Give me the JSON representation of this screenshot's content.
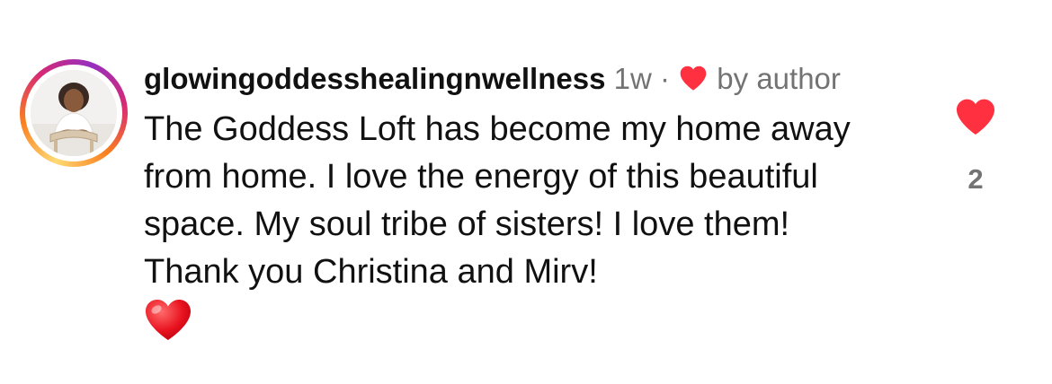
{
  "comment": {
    "username": "glowingoddesshealingnwellness",
    "time": "1w",
    "separator": "·",
    "liked_by_label": "by author",
    "text": "The Goddess Loft has become my home away from home. I love the energy of this beautiful space. My soul tribe of sisters! I love them! Thank you Christina and Mirv!",
    "emoji": "heart-emoji-icon"
  },
  "like": {
    "count": "2",
    "icon": "heart-filled-icon",
    "liked": true
  },
  "colors": {
    "heart_red": "#ff3040",
    "meta_gray": "#737373",
    "text_black": "#111111",
    "ring_gradient": [
      "#feda75",
      "#fa7e1e",
      "#d62976",
      "#962fbf"
    ]
  }
}
